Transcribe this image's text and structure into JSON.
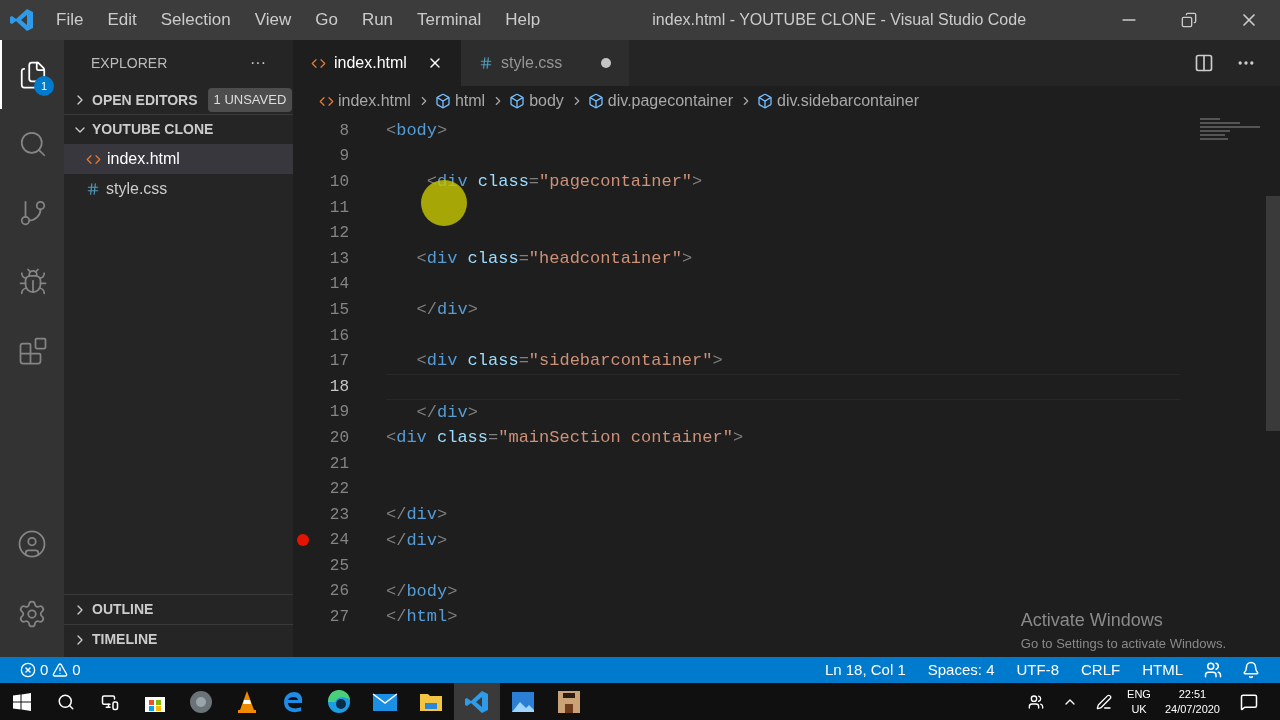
{
  "window": {
    "title": "index.html - YOUTUBE CLONE - Visual Studio Code"
  },
  "menu": [
    "File",
    "Edit",
    "Selection",
    "View",
    "Go",
    "Run",
    "Terminal",
    "Help"
  ],
  "activity_bar": {
    "items": [
      {
        "kind": "explorer",
        "selected": true,
        "badge": "1"
      },
      {
        "kind": "search",
        "selected": false
      },
      {
        "kind": "source-control",
        "selected": false
      },
      {
        "kind": "run",
        "selected": false
      },
      {
        "kind": "extensions",
        "selected": false
      }
    ],
    "bottom": [
      {
        "kind": "account"
      },
      {
        "kind": "settings"
      }
    ]
  },
  "sidebar": {
    "title": "EXPLORER",
    "more": "···",
    "open_editors": {
      "label": "OPEN EDITORS",
      "badge": "1 UNSAVED",
      "expanded": false
    },
    "folder": {
      "label": "YOUTUBE CLONE",
      "expanded": true,
      "files": [
        {
          "name": "index.html",
          "kind": "html",
          "selected": true
        },
        {
          "name": "style.css",
          "kind": "css",
          "selected": false
        }
      ]
    },
    "sections": [
      {
        "label": "OUTLINE",
        "expanded": false
      },
      {
        "label": "TIMELINE",
        "expanded": false
      }
    ]
  },
  "tabs": [
    {
      "label": "index.html",
      "kind": "html",
      "selected": true,
      "dirty": false
    },
    {
      "label": "style.css",
      "kind": "css",
      "selected": false,
      "dirty": true
    }
  ],
  "breadcrumb": [
    {
      "label": "index.html",
      "kind": "file"
    },
    {
      "label": "html",
      "kind": "element"
    },
    {
      "label": "body",
      "kind": "element"
    },
    {
      "label": "div.pagecontainer",
      "kind": "element"
    },
    {
      "label": "div.sidebarcontainer",
      "kind": "element"
    }
  ],
  "editor": {
    "lines": [
      {
        "number": "8",
        "tokens": [
          {
            "kind": "punct",
            "text": "<"
          },
          {
            "kind": "tag",
            "text": "body"
          },
          {
            "kind": "punct",
            "text": ">"
          }
        ]
      },
      {
        "number": "9"
      },
      {
        "number": "10",
        "tokens": [
          {
            "kind": "punct",
            "text": "    <"
          },
          {
            "kind": "tag",
            "text": "div"
          },
          {
            "kind": "attr",
            "text": " class"
          },
          {
            "kind": "punct",
            "text": "="
          },
          {
            "kind": "string",
            "text": "\"pagecontainer\""
          },
          {
            "kind": "punct",
            "text": ">"
          }
        ]
      },
      {
        "number": "11"
      },
      {
        "number": "12"
      },
      {
        "number": "13",
        "tokens": [
          {
            "kind": "punct",
            "text": "   <"
          },
          {
            "kind": "tag",
            "text": "div"
          },
          {
            "kind": "attr",
            "text": " class"
          },
          {
            "kind": "punct",
            "text": "="
          },
          {
            "kind": "string",
            "text": "\"headcontainer\""
          },
          {
            "kind": "punct",
            "text": ">"
          }
        ]
      },
      {
        "number": "14"
      },
      {
        "number": "15",
        "tokens": [
          {
            "kind": "punct",
            "text": "   </"
          },
          {
            "kind": "tag",
            "text": "div"
          },
          {
            "kind": "punct",
            "text": ">"
          }
        ]
      },
      {
        "number": "16"
      },
      {
        "number": "17",
        "tokens": [
          {
            "kind": "punct",
            "text": "   <"
          },
          {
            "kind": "tag",
            "text": "div"
          },
          {
            "kind": "attr",
            "text": " class"
          },
          {
            "kind": "punct",
            "text": "="
          },
          {
            "kind": "string",
            "text": "\"sidebarcontainer\""
          },
          {
            "kind": "punct",
            "text": ">"
          }
        ]
      },
      {
        "number": "18",
        "current": true
      },
      {
        "number": "19",
        "tokens": [
          {
            "kind": "punct",
            "text": "   </"
          },
          {
            "kind": "tag",
            "text": "div"
          },
          {
            "kind": "punct",
            "text": ">"
          }
        ]
      },
      {
        "number": "20",
        "tokens": [
          {
            "kind": "punct",
            "text": "<"
          },
          {
            "kind": "tag",
            "text": "div"
          },
          {
            "kind": "attr",
            "text": " class"
          },
          {
            "kind": "punct",
            "text": "="
          },
          {
            "kind": "string",
            "text": "\"mainSection container\""
          },
          {
            "kind": "punct",
            "text": ">"
          }
        ]
      },
      {
        "number": "21"
      },
      {
        "number": "22"
      },
      {
        "number": "23",
        "tokens": [
          {
            "kind": "punct",
            "text": "</"
          },
          {
            "kind": "tag",
            "text": "div"
          },
          {
            "kind": "punct",
            "text": ">"
          }
        ]
      },
      {
        "number": "24",
        "breakpoint": true,
        "tokens": [
          {
            "kind": "punct",
            "text": "</"
          },
          {
            "kind": "tag",
            "text": "div"
          },
          {
            "kind": "punct",
            "text": ">"
          }
        ]
      },
      {
        "number": "25"
      },
      {
        "number": "26",
        "tokens": [
          {
            "kind": "punct",
            "text": "</"
          },
          {
            "kind": "tag",
            "text": "body"
          },
          {
            "kind": "punct",
            "text": ">"
          }
        ]
      },
      {
        "number": "27",
        "tokens": [
          {
            "kind": "punct",
            "text": "</"
          },
          {
            "kind": "tag",
            "text": "html"
          },
          {
            "kind": "punct",
            "text": ">"
          }
        ]
      }
    ]
  },
  "activation": {
    "title": "Activate Windows",
    "text": "Go to Settings to activate Windows."
  },
  "status_bar": {
    "errors": "0",
    "warnings": "0",
    "items": [
      "Ln 18, Col 1",
      "Spaces: 4",
      "UTF-8",
      "CRLF",
      "HTML"
    ]
  },
  "taskbar": {
    "apps": [
      {
        "kind": "store",
        "selected": false
      },
      {
        "kind": "disc",
        "selected": false
      },
      {
        "kind": "cone",
        "selected": false
      },
      {
        "kind": "edge-old",
        "selected": false
      },
      {
        "kind": "edge",
        "selected": false
      },
      {
        "kind": "mail",
        "selected": false
      },
      {
        "kind": "folder",
        "selected": false
      },
      {
        "kind": "vscode",
        "selected": true
      },
      {
        "kind": "photos",
        "selected": false
      },
      {
        "kind": "game",
        "selected": false
      }
    ],
    "language": "ENG",
    "region": "UK",
    "time": "22:51",
    "date": "24/07/2020"
  }
}
